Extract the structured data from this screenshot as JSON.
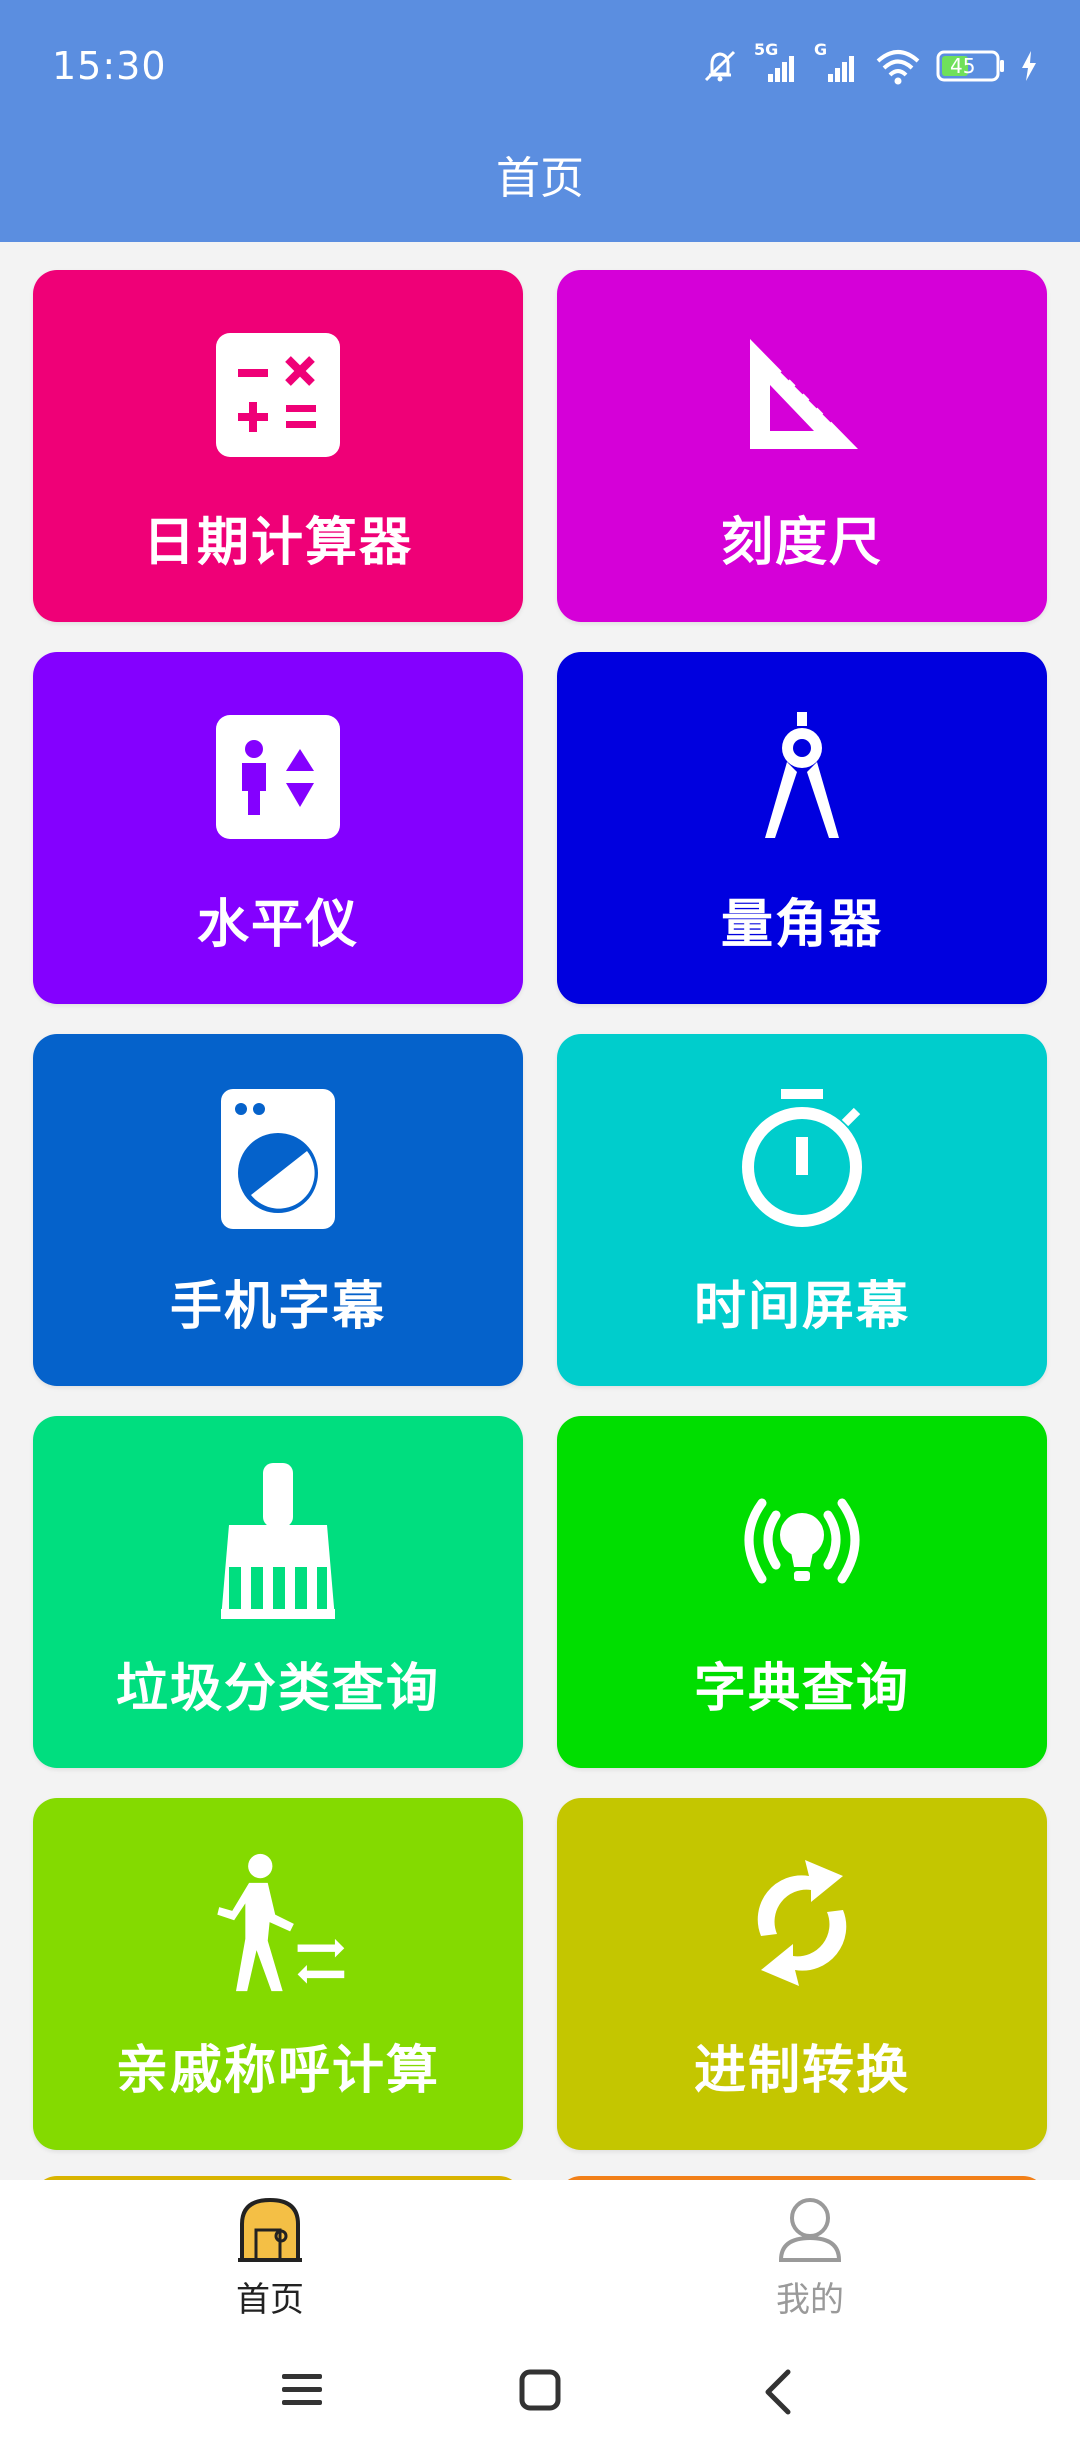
{
  "status_bar": {
    "time": "15:30",
    "battery": "45",
    "network_1": "5G",
    "network_2": "G"
  },
  "header": {
    "title": "首页"
  },
  "tiles": [
    {
      "label": "日期计算器",
      "color": "#ef0077",
      "icon": "calculator-icon"
    },
    {
      "label": "刻度尺",
      "color": "#d500d8",
      "icon": "set-square-icon"
    },
    {
      "label": "水平仪",
      "color": "#8400ff",
      "icon": "elevator-icon"
    },
    {
      "label": "量角器",
      "color": "#0000df",
      "icon": "compass-icon"
    },
    {
      "label": "手机字幕",
      "color": "#0562cb",
      "icon": "washing-machine-icon"
    },
    {
      "label": "时间屏幕",
      "color": "#00cdcc",
      "icon": "stopwatch-icon"
    },
    {
      "label": "垃圾分类查询",
      "color": "#00de7f",
      "icon": "broom-icon"
    },
    {
      "label": "字典查询",
      "color": "#00de00",
      "icon": "idea-broadcast-icon"
    },
    {
      "label": "亲戚称呼计算",
      "color": "#84da00",
      "icon": "walking-person-icon"
    },
    {
      "label": "进制转换",
      "color": "#c4c600",
      "icon": "sync-icon"
    }
  ],
  "peek_colors": [
    "#d9b400",
    "#f28018"
  ],
  "bottom_nav": {
    "home_label": "首页",
    "mine_label": "我的"
  },
  "colors": {
    "header_bg": "#5b8ee0",
    "nav_active": "#222222",
    "nav_inactive": "#9a9a9a",
    "nav_home_icon": "#f4bf45"
  }
}
